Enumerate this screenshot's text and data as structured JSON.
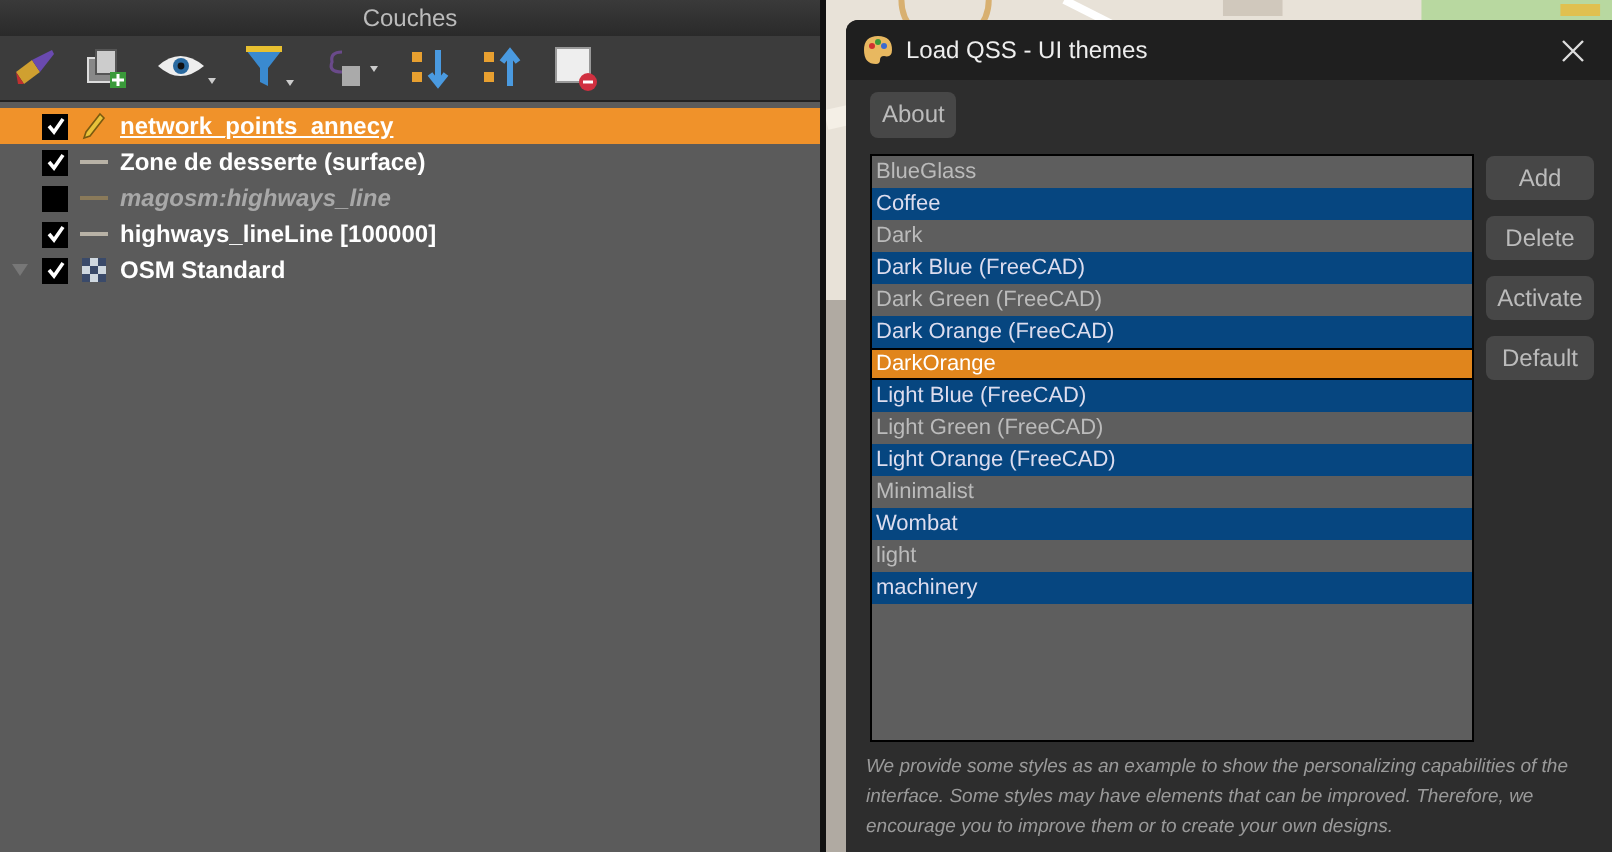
{
  "layers_panel": {
    "title": "Couches",
    "layers": [
      {
        "name": "network_points_annecy",
        "kind": "edit",
        "checked": true,
        "selected": true
      },
      {
        "name": "Zone de desserte (surface)",
        "kind": "line",
        "checked": true,
        "selected": false
      },
      {
        "name": "magosm:highways_line",
        "kind": "line",
        "checked": false,
        "selected": false
      },
      {
        "name": "highways_lineLine [100000]",
        "kind": "line",
        "checked": true,
        "selected": false
      },
      {
        "name": "OSM Standard",
        "kind": "raster",
        "checked": true,
        "selected": false,
        "expanded": true
      }
    ]
  },
  "dialog": {
    "title": "Load QSS - UI themes",
    "about_button": "About",
    "themes": [
      {
        "name": "BlueGlass",
        "selected": false
      },
      {
        "name": "Coffee",
        "selected": false
      },
      {
        "name": "Dark",
        "selected": false
      },
      {
        "name": "Dark Blue (FreeCAD)",
        "selected": false
      },
      {
        "name": "Dark Green (FreeCAD)",
        "selected": false
      },
      {
        "name": "Dark Orange (FreeCAD)",
        "selected": false
      },
      {
        "name": "DarkOrange",
        "selected": true
      },
      {
        "name": "Light Blue (FreeCAD)",
        "selected": false
      },
      {
        "name": "Light Green (FreeCAD)",
        "selected": false
      },
      {
        "name": "Light Orange (FreeCAD)",
        "selected": false
      },
      {
        "name": "Minimalist",
        "selected": false
      },
      {
        "name": "Wombat",
        "selected": false
      },
      {
        "name": "light",
        "selected": false
      },
      {
        "name": "machinery",
        "selected": false
      }
    ],
    "buttons": [
      "Add",
      "Delete",
      "Activate",
      "Default"
    ],
    "note": "We provide some styles as an example to show the personalizing capabilities of the interface. Some styles may have elements that can be improved. Therefore, we encourage you to improve them or to create your own designs."
  }
}
